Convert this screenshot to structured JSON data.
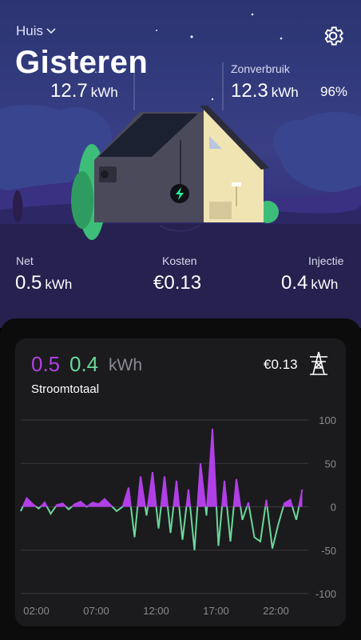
{
  "header": {
    "location": "Huis",
    "title": "Gisteren",
    "left_stat": {
      "label": "...",
      "value": "12.7",
      "unit": "kWh"
    },
    "right_stat": {
      "label": "Zonverbruik",
      "value": "12.3",
      "unit": "kWh",
      "percent": "96%"
    }
  },
  "stats": [
    {
      "label": "Net",
      "value": "0.5",
      "unit": "kWh"
    },
    {
      "label": "Kosten",
      "value": "€0.13",
      "unit": ""
    },
    {
      "label": "Injectie",
      "value": "0.4",
      "unit": "kWh"
    }
  ],
  "card": {
    "net_value": "0.5",
    "injection_value": "0.4",
    "unit": "kWh",
    "subtitle": "Stroomtotaal",
    "cost": "€0.13"
  },
  "colors": {
    "net": "#b13fe6",
    "injection": "#6ad79a",
    "accent": "#24ff95"
  },
  "chart_data": {
    "type": "area",
    "x_tick_labels": [
      "02:00",
      "07:00",
      "12:00",
      "17:00",
      "22:00"
    ],
    "y_tick_labels": [
      "100",
      "50",
      "0",
      "-50",
      "-100"
    ],
    "ylim": [
      -100,
      100
    ],
    "grid": true,
    "x_hours": [
      0,
      0.5,
      1,
      1.5,
      2,
      2.5,
      3,
      3.5,
      4,
      4.5,
      5,
      5.5,
      6,
      6.5,
      7,
      7.5,
      8,
      8.5,
      9,
      9.5,
      10,
      10.5,
      11,
      11.5,
      12,
      12.5,
      13,
      13.5,
      14,
      14.5,
      15,
      15.5,
      16,
      16.5,
      17,
      17.5,
      18,
      18.5,
      19,
      19.5,
      20,
      20.5,
      21,
      21.5,
      22,
      22.5,
      23,
      23.5
    ],
    "values": [
      -5,
      10,
      3,
      -2,
      5,
      -8,
      2,
      4,
      -3,
      3,
      6,
      0,
      5,
      3,
      9,
      2,
      -5,
      0,
      22,
      -35,
      35,
      -10,
      40,
      -25,
      35,
      -30,
      30,
      -38,
      20,
      -50,
      50,
      -10,
      90,
      -45,
      30,
      -40,
      32,
      -15,
      5,
      -35,
      -40,
      8,
      -48,
      -20,
      4,
      8,
      -15,
      20
    ]
  }
}
